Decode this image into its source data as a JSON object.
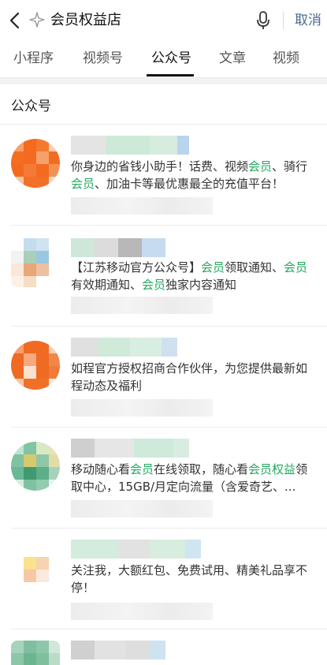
{
  "search": {
    "query": "会员权益店",
    "cancel_label": "取消"
  },
  "tabs": [
    {
      "label": "小程序",
      "active": false
    },
    {
      "label": "视频号",
      "active": false
    },
    {
      "label": "公众号",
      "active": true
    },
    {
      "label": "文章",
      "active": false
    },
    {
      "label": "视频",
      "active": false
    }
  ],
  "section": {
    "title": "公众号"
  },
  "results": [
    {
      "desc_parts": [
        "你身边的省钱小助手！话费、视频",
        "会员",
        "、骑行",
        "会员",
        "、加油卡等最优惠最全的充值平台！"
      ]
    },
    {
      "desc_parts": [
        "【江苏移动官方公众号】",
        "会员",
        "领取通知、",
        "会员",
        "有效期通知、",
        "会员",
        "独家内容通知"
      ]
    },
    {
      "desc_parts": [
        "如程官方授权招商合作伙伴，为您提供最新如程动态及福利"
      ]
    },
    {
      "desc_parts": [
        "移动随心看",
        "会员",
        "在线领取，随心看",
        "会员权益",
        "领取中心，15GB/月定向流量（含爱奇艺、..."
      ]
    },
    {
      "desc_parts": [
        "关注我，大额红包、免费试用、精美礼品享不停！"
      ]
    }
  ],
  "colors": {
    "highlight": "#23a860",
    "cancel": "#4a6a94"
  },
  "icons": [
    "back-chevron-icon",
    "ai-sparkle-icon",
    "microphone-icon"
  ]
}
